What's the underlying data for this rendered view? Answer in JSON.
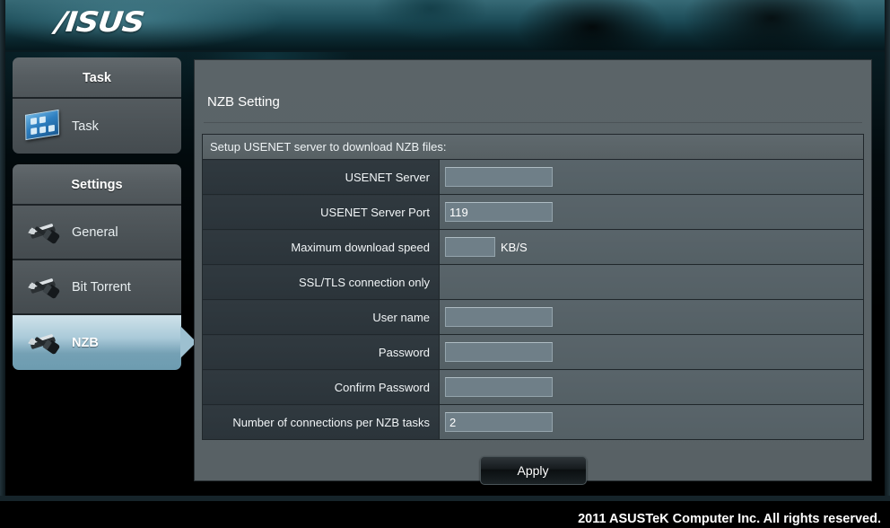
{
  "brand": {
    "logo_text": "/ISUS"
  },
  "sidebar": {
    "panels": [
      {
        "title": "Task",
        "items": [
          {
            "label": "Task",
            "icon": "task-grid-icon",
            "active": false
          }
        ]
      },
      {
        "title": "Settings",
        "items": [
          {
            "label": "General",
            "icon": "tools-icon",
            "active": false
          },
          {
            "label": "Bit Torrent",
            "icon": "tools-icon",
            "active": false
          },
          {
            "label": "NZB",
            "icon": "tools-icon",
            "active": true
          }
        ]
      }
    ]
  },
  "content": {
    "title": "NZB Setting",
    "table_header": "Setup USENET server to download NZB files:",
    "rows": [
      {
        "label": "USENET Server",
        "value": "",
        "field": "wide",
        "unit": ""
      },
      {
        "label": "USENET Server Port",
        "value": "119",
        "field": "wide",
        "unit": ""
      },
      {
        "label": "Maximum download speed",
        "value": "",
        "field": "short",
        "unit": "KB/S"
      },
      {
        "label": "SSL/TLS connection only",
        "value": "",
        "field": "none",
        "unit": ""
      },
      {
        "label": "User name",
        "value": "",
        "field": "wide",
        "unit": ""
      },
      {
        "label": "Password",
        "value": "",
        "field": "wide",
        "unit": ""
      },
      {
        "label": "Confirm Password",
        "value": "",
        "field": "wide",
        "unit": ""
      },
      {
        "label": "Number of connections per NZB tasks",
        "value": "2",
        "field": "wide",
        "unit": ""
      }
    ],
    "apply_label": "Apply"
  },
  "footer": {
    "copyright": "2011 ASUSTeK Computer Inc. All rights reserved."
  },
  "colors": {
    "accent_selected": "#a9c9d8",
    "panel_gray": "#565d61",
    "label_cell": "#2f383e",
    "value_cell": "#58636a",
    "field_fill": "#6f7f88",
    "header_teal": "#1d4d59"
  }
}
